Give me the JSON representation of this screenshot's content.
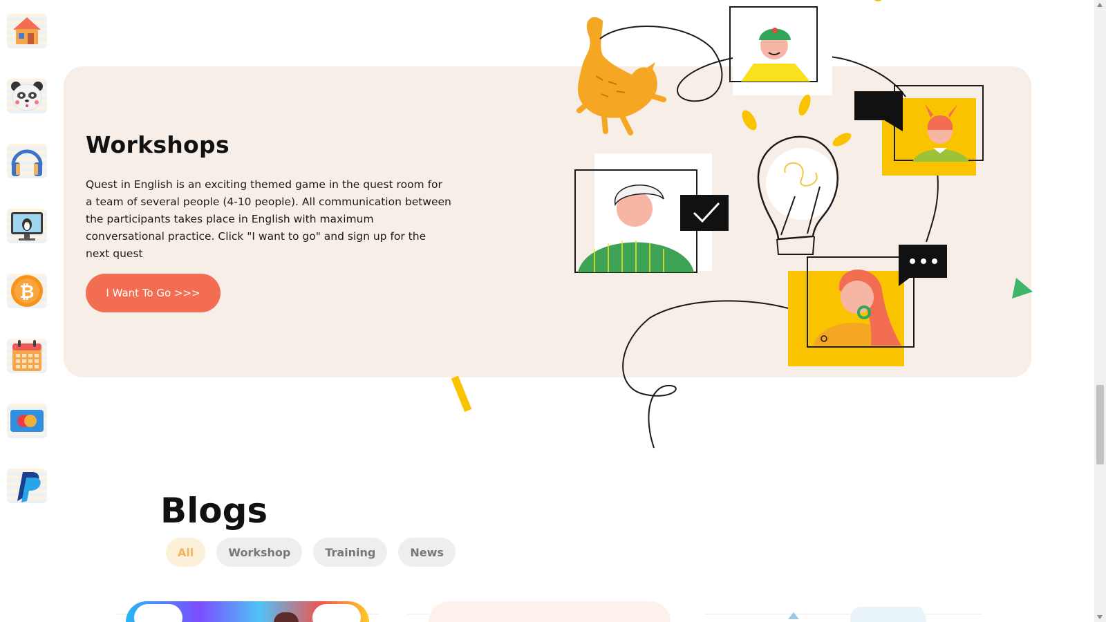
{
  "sidebar": {
    "items": [
      {
        "icon": "house-icon",
        "label": ""
      },
      {
        "icon": "panda-icon",
        "label": ""
      },
      {
        "icon": "headphones-icon",
        "label": ""
      },
      {
        "icon": "penguin-monitor-icon",
        "label": ""
      },
      {
        "icon": "bitcoin-icon",
        "label": ""
      },
      {
        "icon": "calendar-icon",
        "label": ""
      },
      {
        "icon": "mastercard-icon",
        "label": ""
      },
      {
        "icon": "paypal-icon",
        "label": ""
      }
    ]
  },
  "workshops": {
    "title": "Workshops",
    "description": "Quest in English is an exciting themed game in the quest room for a team of several people (4-10 people). All communication between the participants takes place in English with maximum conversational practice. Click \"I want to go\" and sign up for the next quest",
    "button_label": "I Want To Go >>>"
  },
  "blogs": {
    "title": "Blogs",
    "filters": [
      "All",
      "Workshop",
      "Training",
      "News"
    ],
    "active_filter": "All"
  },
  "colors": {
    "accent": "#f36d52",
    "card_bg": "#f8eee8",
    "active_chip_text": "#f2b35a",
    "active_chip_bg": "#fdf0d8",
    "illustration_yellow": "#f9c300"
  }
}
